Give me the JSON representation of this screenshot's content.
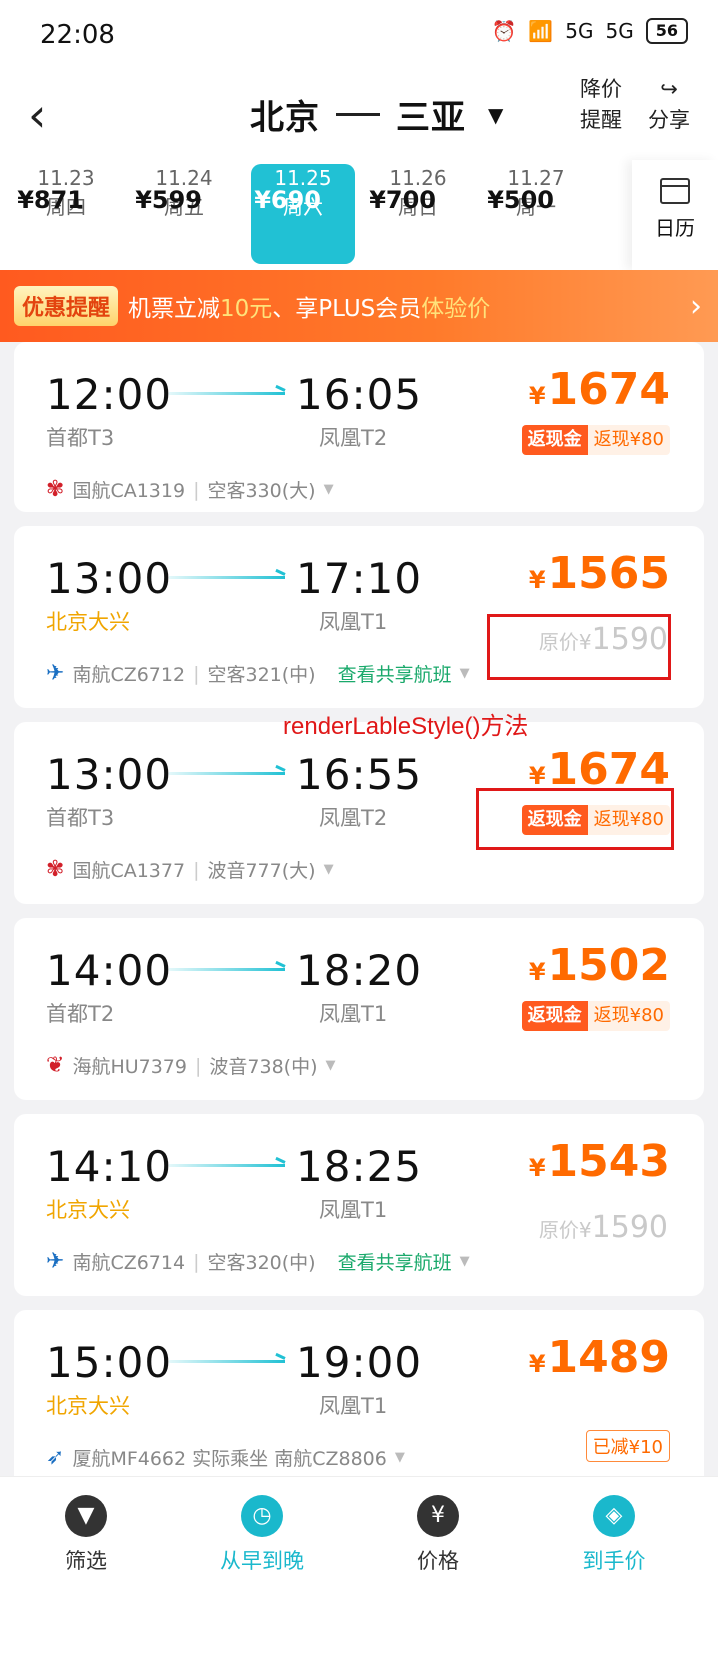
{
  "status": {
    "time": "22:08",
    "signal1": "5G",
    "signal2": "5G",
    "battery": "56"
  },
  "header": {
    "origin": "北京",
    "destination": "三亚",
    "price_alert_line1": "降价",
    "price_alert_line2": "提醒",
    "share_label": "分享"
  },
  "dates": [
    {
      "date": "11.23",
      "weekday": "周四",
      "price": "¥871"
    },
    {
      "date": "11.24",
      "weekday": "周五",
      "price": "¥599"
    },
    {
      "date": "11.25",
      "weekday": "周六",
      "price": "¥690"
    },
    {
      "date": "11.26",
      "weekday": "周日",
      "price": "¥700"
    },
    {
      "date": "11.27",
      "weekday": "周一",
      "price": "¥500"
    }
  ],
  "calendar_label": "日历",
  "promo": {
    "tag": "优惠提醒",
    "text_a": "机票立减",
    "amount": "10元",
    "text_b": "、享PLUS会员",
    "highlight": "体验价"
  },
  "flights": [
    {
      "dep": "12:00",
      "arr": "16:05",
      "dep_ap": "首都T3",
      "arr_ap": "凤凰T2",
      "price": "1674",
      "cash_tag": "返现金",
      "cash_val": "返现¥80",
      "airline": "国航CA1319",
      "aircraft": "空客330(大)"
    },
    {
      "dep": "13:00",
      "arr": "17:10",
      "dep_ap": "北京大兴",
      "arr_ap": "凤凰T1",
      "price": "1565",
      "orig_price": "1590",
      "orig_label": "原价",
      "airline": "南航CZ6712",
      "aircraft": "空客321(中)",
      "share": "查看共享航班"
    },
    {
      "dep": "13:00",
      "arr": "16:55",
      "dep_ap": "首都T3",
      "arr_ap": "凤凰T2",
      "price": "1674",
      "cash_tag": "返现金",
      "cash_val": "返现¥80",
      "airline": "国航CA1377",
      "aircraft": "波音777(大)"
    },
    {
      "dep": "14:00",
      "arr": "18:20",
      "dep_ap": "首都T2",
      "arr_ap": "凤凰T1",
      "price": "1502",
      "cash_tag": "返现金",
      "cash_val": "返现¥80",
      "airline": "海航HU7379",
      "aircraft": "波音738(中)"
    },
    {
      "dep": "14:10",
      "arr": "18:25",
      "dep_ap": "北京大兴",
      "arr_ap": "凤凰T1",
      "price": "1543",
      "orig_price": "1590",
      "orig_label": "原价",
      "airline": "南航CZ6714",
      "aircraft": "空客320(中)",
      "share": "查看共享航班"
    },
    {
      "dep": "15:00",
      "arr": "19:00",
      "dep_ap": "北京大兴",
      "arr_ap": "凤凰T1",
      "price": "1489",
      "reduce": "已减¥10",
      "airline": "厦航MF4662 实际乘坐 南航CZ8806"
    }
  ],
  "annotation": "renderLableStyle()方法",
  "tabs": [
    {
      "label": "筛选",
      "icon": "filter-icon"
    },
    {
      "label": "从早到晚",
      "icon": "clock-icon"
    },
    {
      "label": "价格",
      "icon": "yen-icon"
    },
    {
      "label": "到手价",
      "icon": "tag-icon"
    }
  ],
  "colors": {
    "accent": "#21c1d4",
    "price": "#ff6a00",
    "annotation": "#e01818"
  }
}
